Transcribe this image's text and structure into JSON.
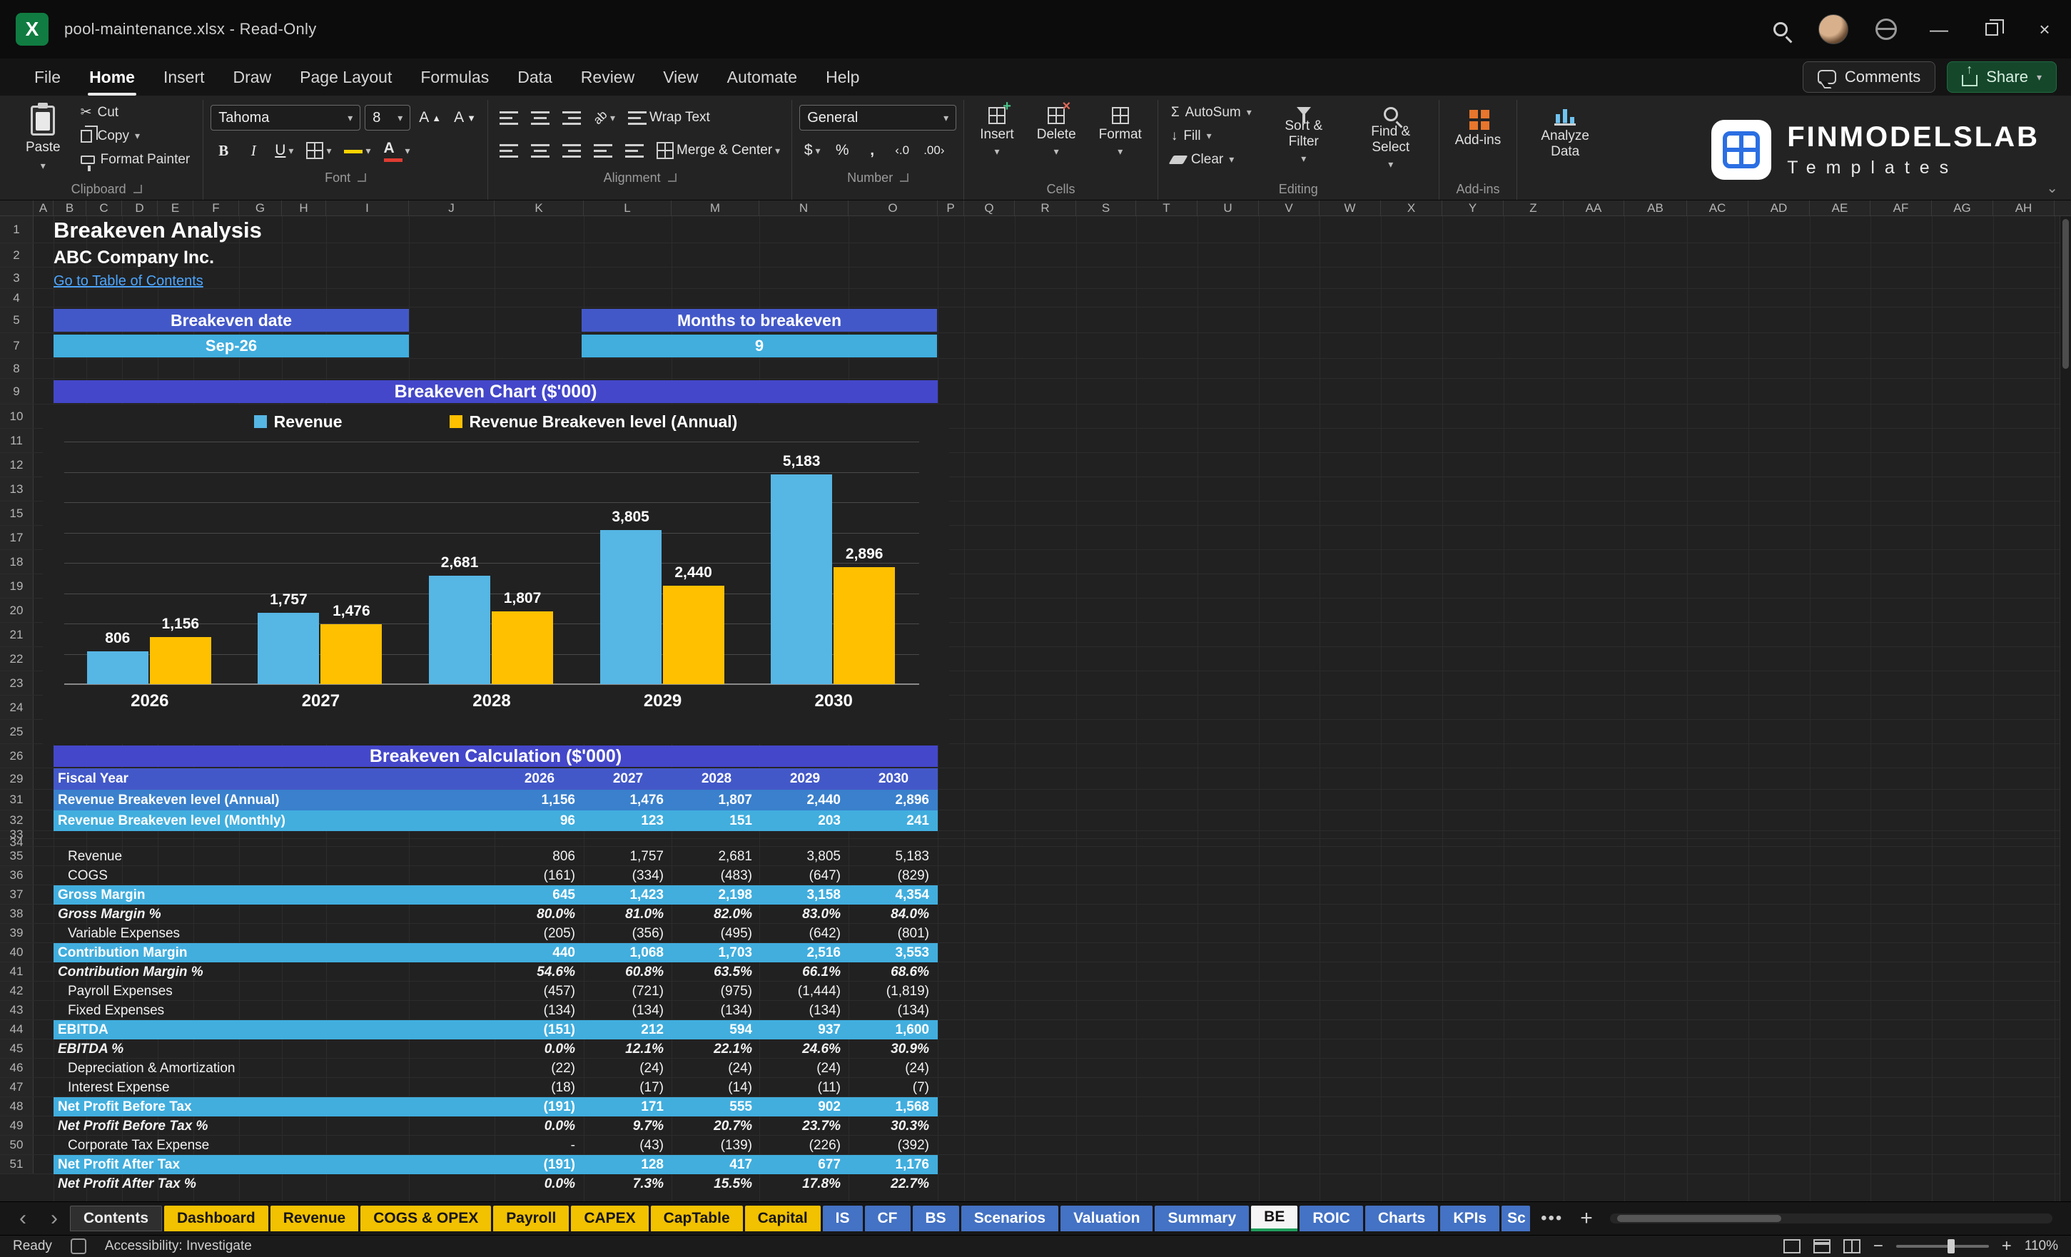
{
  "titlebar": {
    "title": "pool-maintenance.xlsx  -  Read-Only"
  },
  "menu": {
    "items": [
      "File",
      "Home",
      "Insert",
      "Draw",
      "Page Layout",
      "Formulas",
      "Data",
      "Review",
      "View",
      "Automate",
      "Help"
    ],
    "active": "Home",
    "comments_label": "Comments",
    "share_label": "Share"
  },
  "ribbon": {
    "clipboard": {
      "caption": "Clipboard",
      "paste": "Paste",
      "cut": "Cut",
      "copy": "Copy",
      "format_painter": "Format Painter"
    },
    "font": {
      "caption": "Font",
      "family": "Tahoma",
      "size": "8"
    },
    "alignment": {
      "caption": "Alignment",
      "wrap": "Wrap Text",
      "merge": "Merge & Center"
    },
    "number": {
      "caption": "Number",
      "format": "General"
    },
    "cells": {
      "caption": "Cells",
      "insert": "Insert",
      "delete": "Delete",
      "format": "Format"
    },
    "editing": {
      "caption": "Editing",
      "autosum": "AutoSum",
      "fill": "Fill",
      "clear": "Clear",
      "sort": "Sort & Filter",
      "find": "Find & Select"
    },
    "addins": {
      "caption": "Add-ins",
      "label": "Add-ins",
      "analyze": "Analyze Data"
    },
    "logo": {
      "line1": "FINMODELSLAB",
      "line2": "Templates"
    }
  },
  "grid": {
    "columns": [
      "A",
      "B",
      "C",
      "D",
      "E",
      "F",
      "G",
      "H",
      "I",
      "J",
      "K",
      "L",
      "M",
      "N",
      "O",
      "P",
      "Q",
      "R",
      "S",
      "T",
      "U",
      "V",
      "W",
      "X",
      "Y",
      "Z",
      "AA",
      "AB",
      "AC",
      "AD",
      "AE",
      "AF",
      "AG",
      "AH"
    ],
    "rows": [
      1,
      2,
      3,
      4,
      5,
      7,
      8,
      9,
      10,
      11,
      12,
      13,
      15,
      17,
      18,
      19,
      20,
      21,
      22,
      23,
      24,
      25,
      26,
      29,
      31,
      32,
      33,
      34,
      35,
      36,
      37,
      38,
      39,
      40,
      41,
      42,
      43,
      44,
      45,
      46,
      47,
      48,
      49,
      50,
      51
    ]
  },
  "sheet": {
    "title": "Breakeven Analysis",
    "company": "ABC Company Inc.",
    "link": "Go to Table of Contents",
    "breakeven_date_label": "Breakeven date",
    "breakeven_date_value": "Sep-26",
    "months_label": "Months to breakeven",
    "months_value": "9",
    "chart_header": "Breakeven Chart ($'000)",
    "calc_header": "Breakeven Calculation ($'000)",
    "table": {
      "header": [
        "Fiscal Year",
        "2026",
        "2027",
        "2028",
        "2029",
        "2030"
      ],
      "rows": [
        {
          "label": "Revenue Breakeven level (Annual)",
          "values": [
            "1,156",
            "1,476",
            "1,807",
            "2,440",
            "2,896"
          ],
          "style": "annual"
        },
        {
          "label": "Revenue Breakeven level (Monthly)",
          "values": [
            "96",
            "123",
            "151",
            "203",
            "241"
          ],
          "style": "monthly"
        },
        {
          "style": "spacer"
        },
        {
          "label": "Revenue",
          "values": [
            "806",
            "1,757",
            "2,681",
            "3,805",
            "5,183"
          ],
          "style": "plain"
        },
        {
          "label": "COGS",
          "values": [
            "(161)",
            "(334)",
            "(483)",
            "(647)",
            "(829)"
          ],
          "style": "plain"
        },
        {
          "label": "Gross Margin",
          "values": [
            "645",
            "1,423",
            "2,198",
            "3,158",
            "4,354"
          ],
          "style": "total"
        },
        {
          "label": "Gross Margin %",
          "values": [
            "80.0%",
            "81.0%",
            "82.0%",
            "83.0%",
            "84.0%"
          ],
          "style": "pct"
        },
        {
          "label": "Variable Expenses",
          "values": [
            "(205)",
            "(356)",
            "(495)",
            "(642)",
            "(801)"
          ],
          "style": "plain"
        },
        {
          "label": "Contribution Margin",
          "values": [
            "440",
            "1,068",
            "1,703",
            "2,516",
            "3,553"
          ],
          "style": "total"
        },
        {
          "label": "Contribution Margin %",
          "values": [
            "54.6%",
            "60.8%",
            "63.5%",
            "66.1%",
            "68.6%"
          ],
          "style": "pct"
        },
        {
          "label": "Payroll Expenses",
          "values": [
            "(457)",
            "(721)",
            "(975)",
            "(1,444)",
            "(1,819)"
          ],
          "style": "plain"
        },
        {
          "label": "Fixed Expenses",
          "values": [
            "(134)",
            "(134)",
            "(134)",
            "(134)",
            "(134)"
          ],
          "style": "plain"
        },
        {
          "label": "EBITDA",
          "values": [
            "(151)",
            "212",
            "594",
            "937",
            "1,600"
          ],
          "style": "total"
        },
        {
          "label": "EBITDA %",
          "values": [
            "0.0%",
            "12.1%",
            "22.1%",
            "24.6%",
            "30.9%"
          ],
          "style": "pct"
        },
        {
          "label": "Depreciation & Amortization",
          "values": [
            "(22)",
            "(24)",
            "(24)",
            "(24)",
            "(24)"
          ],
          "style": "plain"
        },
        {
          "label": "Interest Expense",
          "values": [
            "(18)",
            "(17)",
            "(14)",
            "(11)",
            "(7)"
          ],
          "style": "plain"
        },
        {
          "label": "Net Profit Before Tax",
          "values": [
            "(191)",
            "171",
            "555",
            "902",
            "1,568"
          ],
          "style": "total"
        },
        {
          "label": "Net Profit Before Tax %",
          "values": [
            "0.0%",
            "9.7%",
            "20.7%",
            "23.7%",
            "30.3%"
          ],
          "style": "pct"
        },
        {
          "label": "Corporate Tax Expense",
          "values": [
            "-",
            "(43)",
            "(139)",
            "(226)",
            "(392)"
          ],
          "style": "plain"
        },
        {
          "label": "Net Profit After Tax",
          "values": [
            "(191)",
            "128",
            "417",
            "677",
            "1,176"
          ],
          "style": "total"
        },
        {
          "label": "Net Profit After Tax %",
          "values": [
            "0.0%",
            "7.3%",
            "15.5%",
            "17.8%",
            "22.7%"
          ],
          "style": "pct"
        }
      ]
    }
  },
  "chart_data": {
    "type": "bar",
    "title": "Breakeven Chart ($'000)",
    "categories": [
      "2026",
      "2027",
      "2028",
      "2029",
      "2030"
    ],
    "series": [
      {
        "name": "Revenue",
        "color": "#56b6e4",
        "values": [
          806,
          1757,
          2681,
          3805,
          5183
        ]
      },
      {
        "name": "Revenue Breakeven level (Annual)",
        "color": "#ffc000",
        "values": [
          1156,
          1476,
          1807,
          2440,
          2896
        ]
      }
    ],
    "ylim": [
      0,
      6000
    ],
    "gridline_intervals": 8,
    "legend_position": "top",
    "value_labels": true
  },
  "tabs": {
    "items": [
      {
        "label": "Contents",
        "type": "dark"
      },
      {
        "label": "Dashboard",
        "type": "yellow"
      },
      {
        "label": "Revenue",
        "type": "yellow"
      },
      {
        "label": "COGS & OPEX",
        "type": "yellow"
      },
      {
        "label": "Payroll",
        "type": "yellow"
      },
      {
        "label": "CAPEX",
        "type": "yellow"
      },
      {
        "label": "CapTable",
        "type": "yellow"
      },
      {
        "label": "Capital",
        "type": "yellow"
      },
      {
        "label": "IS",
        "type": "blue"
      },
      {
        "label": "CF",
        "type": "blue"
      },
      {
        "label": "BS",
        "type": "blue"
      },
      {
        "label": "Scenarios",
        "type": "blue"
      },
      {
        "label": "Valuation",
        "type": "blue"
      },
      {
        "label": "Summary",
        "type": "blue"
      },
      {
        "label": "BE",
        "type": "active"
      },
      {
        "label": "ROIC",
        "type": "blue"
      },
      {
        "label": "Charts",
        "type": "blue"
      },
      {
        "label": "KPIs",
        "type": "blue"
      },
      {
        "label": "Sc",
        "type": "blue clipped"
      }
    ],
    "more": "•••",
    "add": "+"
  },
  "status": {
    "ready": "Ready",
    "accessibility": "Accessibility: Investigate",
    "zoom": "110%"
  },
  "colors": {
    "section_header": "#4447c9",
    "label_bar": "#4358c8",
    "annual_row": "#3a80cc",
    "cyan_row": "#41aede",
    "bar_blue": "#56b6e4",
    "bar_yellow": "#ffc000",
    "tab_yellow": "#f2c100",
    "tab_blue": "#4472c4",
    "link_blue": "#4da6ff"
  }
}
